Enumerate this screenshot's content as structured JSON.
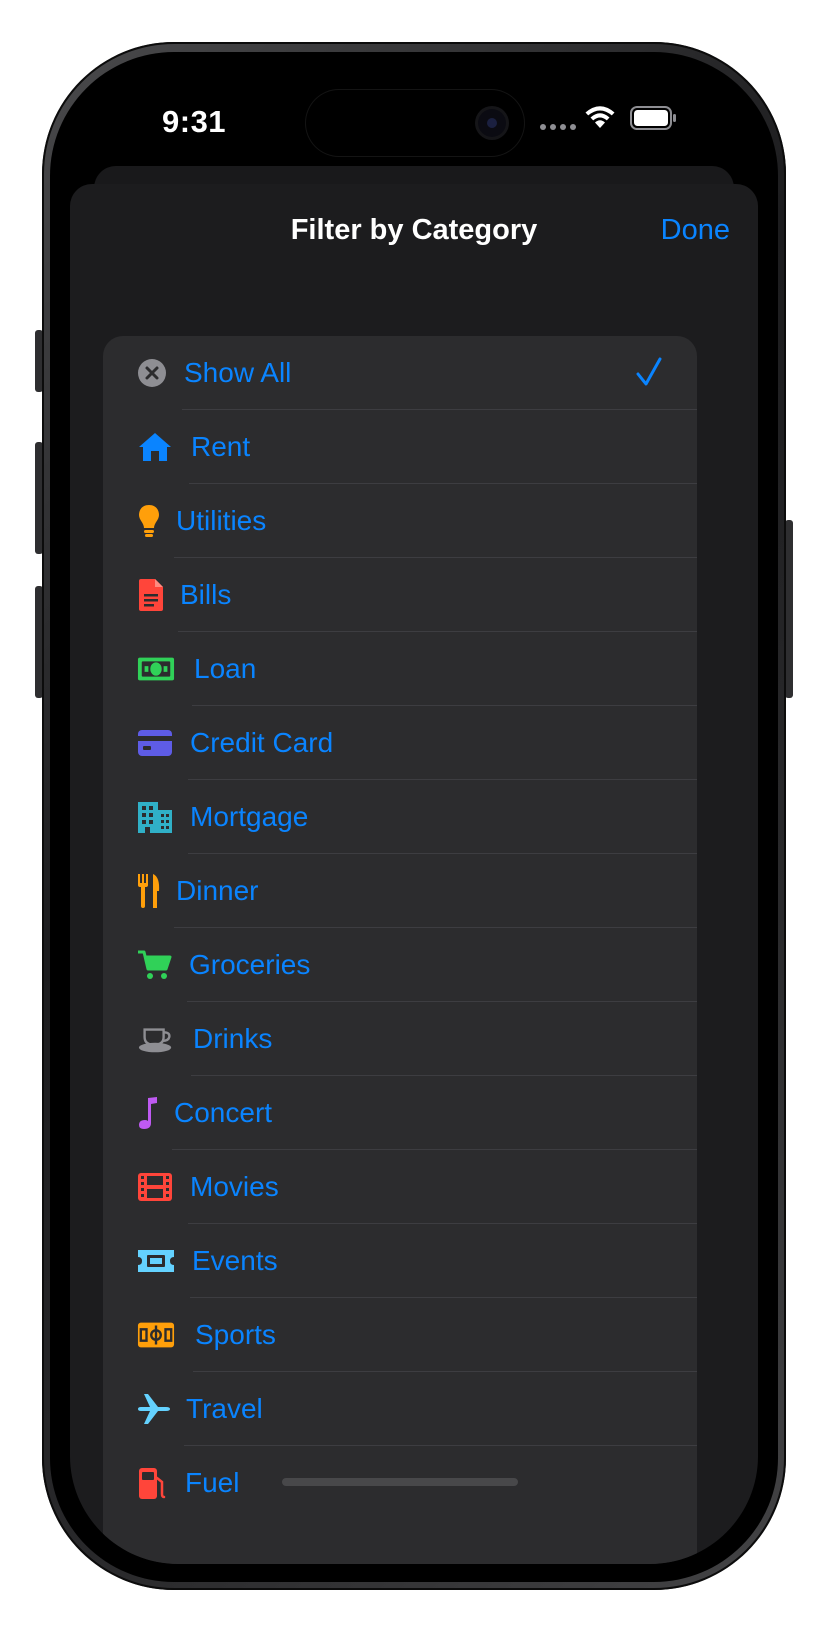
{
  "status_bar": {
    "time": "9:31"
  },
  "sheet": {
    "title": "Filter by Category",
    "done_label": "Done"
  },
  "categories": [
    {
      "label": "Show All",
      "icon": "xmark-circle-icon",
      "color": "#8e8e93",
      "selected": true
    },
    {
      "label": "Rent",
      "icon": "house-icon",
      "color": "#0a84ff"
    },
    {
      "label": "Utilities",
      "icon": "lightbulb-icon",
      "color": "#ff9f0a"
    },
    {
      "label": "Bills",
      "icon": "document-icon",
      "color": "#ff453a"
    },
    {
      "label": "Loan",
      "icon": "banknote-icon",
      "color": "#30d158"
    },
    {
      "label": "Credit Card",
      "icon": "creditcard-icon",
      "color": "#5e5ce6"
    },
    {
      "label": "Mortgage",
      "icon": "building-icon",
      "color": "#30b0c7"
    },
    {
      "label": "Dinner",
      "icon": "fork-knife-icon",
      "color": "#ff9f0a"
    },
    {
      "label": "Groceries",
      "icon": "cart-icon",
      "color": "#30d158"
    },
    {
      "label": "Drinks",
      "icon": "cup-saucer-icon",
      "color": "#8e8e93"
    },
    {
      "label": "Concert",
      "icon": "music-note-icon",
      "color": "#bf5af2"
    },
    {
      "label": "Movies",
      "icon": "film-icon",
      "color": "#ff453a"
    },
    {
      "label": "Events",
      "icon": "ticket-icon",
      "color": "#64d2ff"
    },
    {
      "label": "Sports",
      "icon": "sportscourt-icon",
      "color": "#ff9f0a"
    },
    {
      "label": "Travel",
      "icon": "airplane-icon",
      "color": "#64d2ff"
    },
    {
      "label": "Fuel",
      "icon": "fuelpump-icon",
      "color": "#ff453a"
    }
  ]
}
